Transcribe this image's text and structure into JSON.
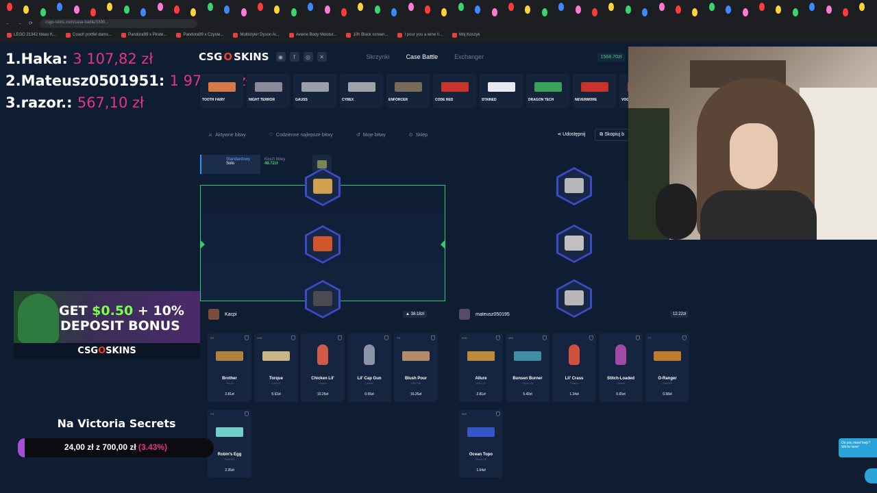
{
  "browser": {
    "url": "csgo-skins.com/case-battle/3390...",
    "bookmarks": [
      "LEGO 21342 Ideas K...",
      "Coach portfel dams...",
      "Pandora99 x Pirate...",
      "Pandora99 x Czyste...",
      "Multistyler Dyson Ai...",
      "Aveine Body Moistur...",
      "10h Black screen...",
      "I pour you a wine Il...",
      "Moj Koszyk"
    ]
  },
  "leaderboard": [
    {
      "name": "1.Haka:",
      "amount": "3 107,82 zł"
    },
    {
      "name": "2.Mateusz0501951:",
      "amount": "1 976,20 zł"
    },
    {
      "name": "3.razor.:",
      "amount": "567,10 zł"
    }
  ],
  "site": {
    "logo_a": "CSG",
    "logo_o": "O",
    "logo_b": "SKINS",
    "nav": [
      "Skrzynki",
      "Case Battle",
      "Exchanger"
    ],
    "balance": "1568.70zł"
  },
  "drops": [
    "TOOTH FAIRY",
    "NIGHT TERROR",
    "GAUSS",
    "CYREX",
    "ENFORCER",
    "CODE RED",
    "STAINED",
    "DRAGON TECH",
    "NEVERMORE",
    "VOGUE"
  ],
  "subnav": {
    "items": [
      "Aktywne bitwy",
      "Codzienne najlepsze bitwy",
      "Moje bitwy",
      "Sklep"
    ],
    "share": "Udostępnij",
    "copy": "Skopiuj b"
  },
  "mode": {
    "type": "Standardowy",
    "sub": "Solo",
    "cost_label": "Koszt bitwy",
    "cost": "48.72zł"
  },
  "players": [
    {
      "name": "Kacpi",
      "total": "38.18zł",
      "items": [
        {
          "wear": "BS",
          "name": "Brother",
          "type": "Tec-9",
          "price": "2.81zł",
          "kind": "gun",
          "color": "#b0823a"
        },
        {
          "wear": "WW",
          "name": "Torque",
          "type": "USP-S",
          "price": "5.92zł",
          "kind": "gun",
          "color": "#c9b483"
        },
        {
          "wear": "",
          "name": "Chicken Lil'",
          "type": "Charm",
          "price": "10.29zł",
          "kind": "charm",
          "color": "#d05a4a"
        },
        {
          "wear": "",
          "name": "Lil' Cap Gun",
          "type": "Charm",
          "price": "0.55zł",
          "kind": "charm",
          "color": "#8a94a6"
        },
        {
          "wear": "FN",
          "name": "Blush Pour",
          "type": "SSG 08",
          "price": "16.25zł",
          "kind": "gun",
          "color": "#b58a6a"
        },
        {
          "wear": "FN",
          "name": "Robin's Egg",
          "type": "Galil AR",
          "price": "2.35zł",
          "kind": "gun",
          "color": "#6fd1c7"
        }
      ]
    },
    {
      "name": "mateusz050195",
      "total": "12.22zł",
      "items": [
        {
          "wear": "WW",
          "name": "Allure",
          "type": "MAC-10",
          "price": "2.81zł",
          "kind": "gun",
          "color": "#c08a3c"
        },
        {
          "wear": "MW",
          "name": "Bunsen Burner",
          "type": "Glock-18",
          "price": "5.42zł",
          "kind": "gun",
          "color": "#3d8fa6"
        },
        {
          "wear": "",
          "name": "Lil' Crass",
          "type": "Charm",
          "price": "1.34zł",
          "kind": "charm",
          "color": "#d0503e"
        },
        {
          "wear": "",
          "name": "Stitch-Loaded",
          "type": "Charm",
          "price": "0.65zł",
          "kind": "charm",
          "color": "#a24aa6"
        },
        {
          "wear": "FT",
          "name": "O-Ranger",
          "type": "Galil AR",
          "price": "0.58zł",
          "kind": "gun",
          "color": "#c27a2c"
        },
        {
          "wear": "MW",
          "name": "Ocean Topo",
          "type": "Glock-18",
          "price": "1.64zł",
          "kind": "gun",
          "color": "#3556c7"
        }
      ]
    }
  ],
  "ad": {
    "line1_a": "GET ",
    "line1_b": "$0.50",
    "line1_c": " + 10%",
    "line2": "DEPOSIT BONUS",
    "logo": "CSGOSKINS"
  },
  "goal": {
    "title": "Na Victoria Secrets",
    "current": "24,00 zł",
    "sep": "z",
    "target": "700,00 zł",
    "pct_label": "(3.43%)",
    "fraction": 0.0343
  },
  "chat": {
    "text": "Do you need help? We're here!"
  },
  "colors": {
    "accent_pink": "#e5338a",
    "win_green": "#2ecc71",
    "brand_red": "#e8442b"
  }
}
